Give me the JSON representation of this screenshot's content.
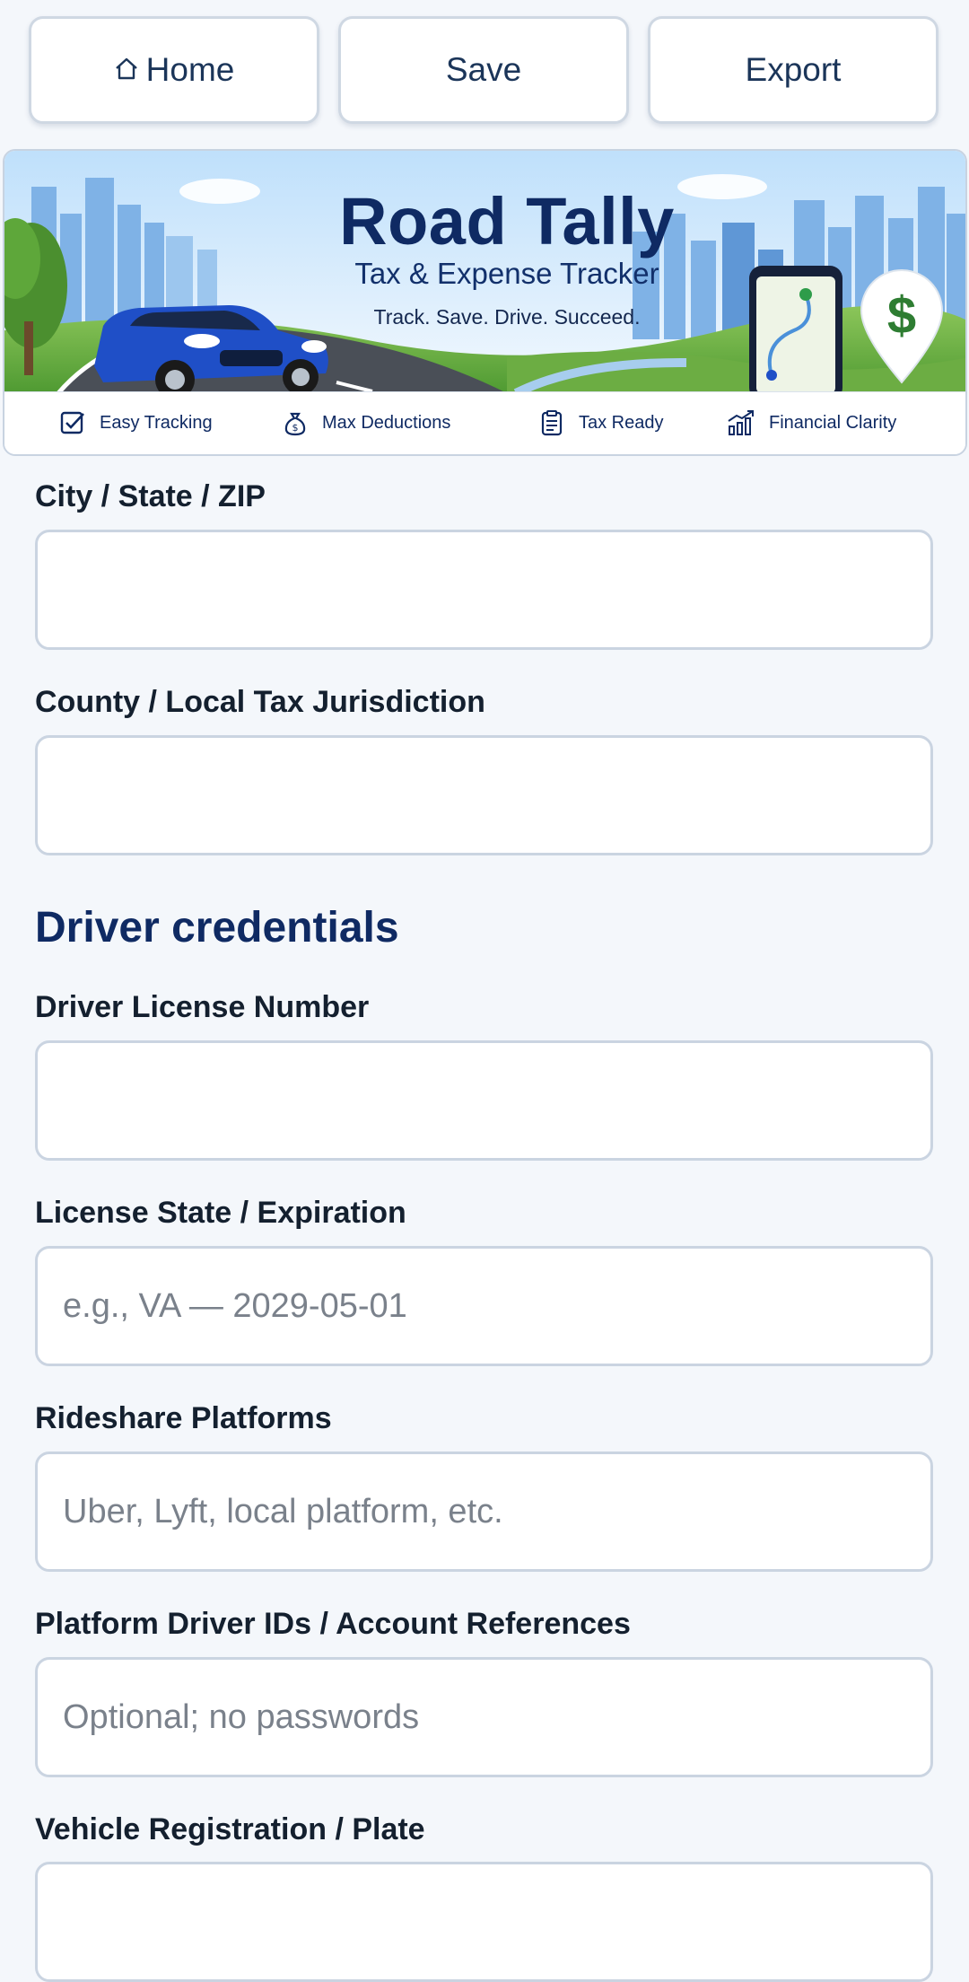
{
  "nav": {
    "home_label": "Home",
    "home_icon": "home-icon",
    "save_label": "Save",
    "export_label": "Export"
  },
  "banner": {
    "title": "Road Tally",
    "subtitle": "Tax & Expense Tracker",
    "tagline": "Track. Save. Drive. Succeed.",
    "pin_symbol": "$",
    "features": [
      {
        "label": "Easy Tracking",
        "icon": "checkbox-icon"
      },
      {
        "label": "Max Deductions",
        "icon": "money-bag-icon"
      },
      {
        "label": "Tax Ready",
        "icon": "clipboard-icon"
      },
      {
        "label": "Financial Clarity",
        "icon": "growth-chart-icon"
      }
    ]
  },
  "form": {
    "city_state_zip": {
      "label": "City / State / ZIP",
      "value": "",
      "placeholder": ""
    },
    "county": {
      "label": "County / Local Tax Jurisdiction",
      "value": "",
      "placeholder": ""
    },
    "credentials_heading": "Driver credentials",
    "license_number": {
      "label": "Driver License Number",
      "value": "",
      "placeholder": ""
    },
    "license_state": {
      "label": "License State / Expiration",
      "value": "",
      "placeholder": "e.g., VA — 2029-05-01"
    },
    "platforms": {
      "label": "Rideshare Platforms",
      "value": "",
      "placeholder": "Uber, Lyft, local platform, etc."
    },
    "platform_ids": {
      "label": "Platform Driver IDs / Account References",
      "value": "",
      "placeholder": "Optional; no passwords"
    },
    "vehicle_registration": {
      "label": "Vehicle Registration / Plate",
      "value": "",
      "placeholder": ""
    }
  },
  "colors": {
    "brand_navy": "#0f2a63",
    "page_bg": "#f4f7fb",
    "field_border": "#cad4e1",
    "car_blue": "#1f4fc7",
    "pin_green": "#2e7d32"
  }
}
